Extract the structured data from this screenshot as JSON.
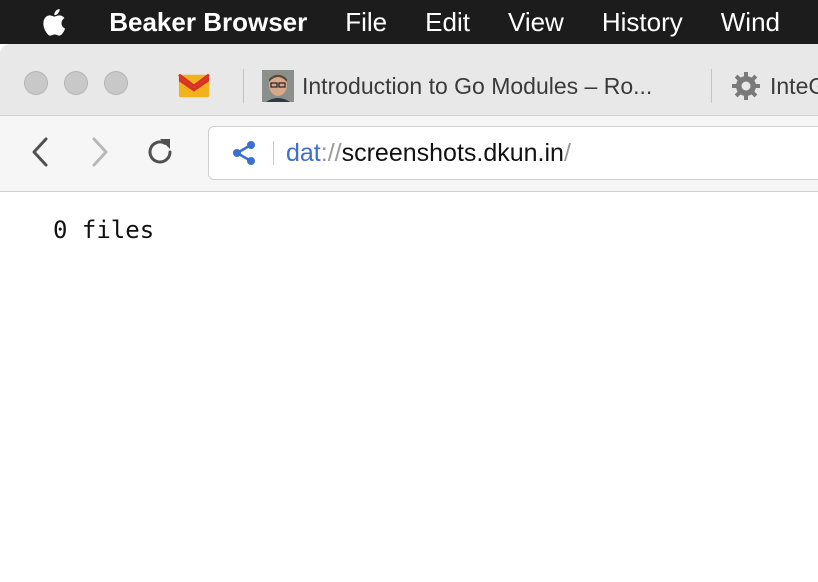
{
  "menubar": {
    "app_name": "Beaker Browser",
    "items": [
      "File",
      "Edit",
      "View",
      "History",
      "Wind"
    ]
  },
  "tabs": [
    {
      "icon": "mail-icon",
      "title": ""
    },
    {
      "icon": "avatar-icon",
      "title": "Introduction to Go Modules – Ro..."
    },
    {
      "icon": "gear-icon",
      "title": "InteG"
    }
  ],
  "navigation": {
    "back_icon": "chevron-left-icon",
    "forward_icon": "chevron-right-icon",
    "reload_icon": "reload-icon"
  },
  "address": {
    "share_icon": "share-icon",
    "scheme": "dat",
    "separator": "://",
    "host": "screenshots.dkun.in",
    "trailing": "/"
  },
  "page": {
    "file_count": "0 files"
  },
  "colors": {
    "menubar_bg": "#1c1c1c",
    "link_blue": "#3b6fd0",
    "mail_red": "#d93025",
    "mail_yellow": "#f2b21b"
  }
}
